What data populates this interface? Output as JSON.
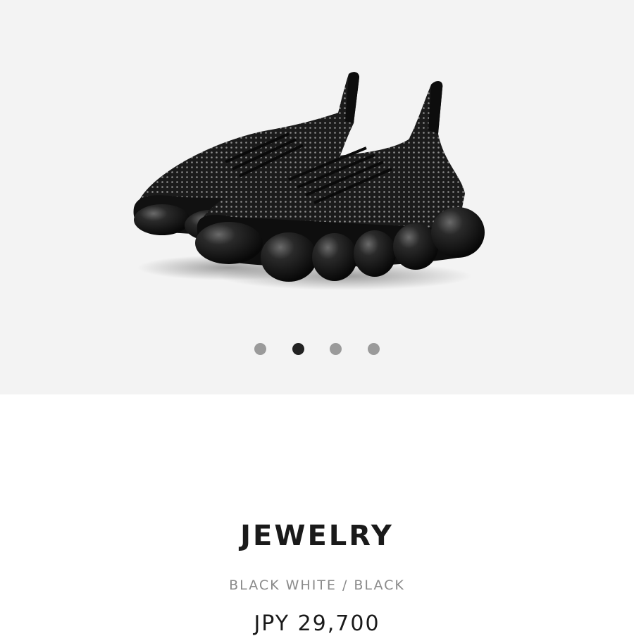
{
  "product": {
    "name": "JEWELRY",
    "color": "BLACK WHITE / BLACK",
    "price": "JPY 29,700"
  },
  "gallery": {
    "image": "black-knit-sneakers-with-bubble-sole",
    "slide_count": 4,
    "active_slide": 2,
    "background": "#f3f3f3"
  },
  "colors": {
    "dot_inactive": "#9a9a9a",
    "dot_active": "#222222",
    "title": "#1a1a1a",
    "subtitle": "#8a8a8a"
  }
}
